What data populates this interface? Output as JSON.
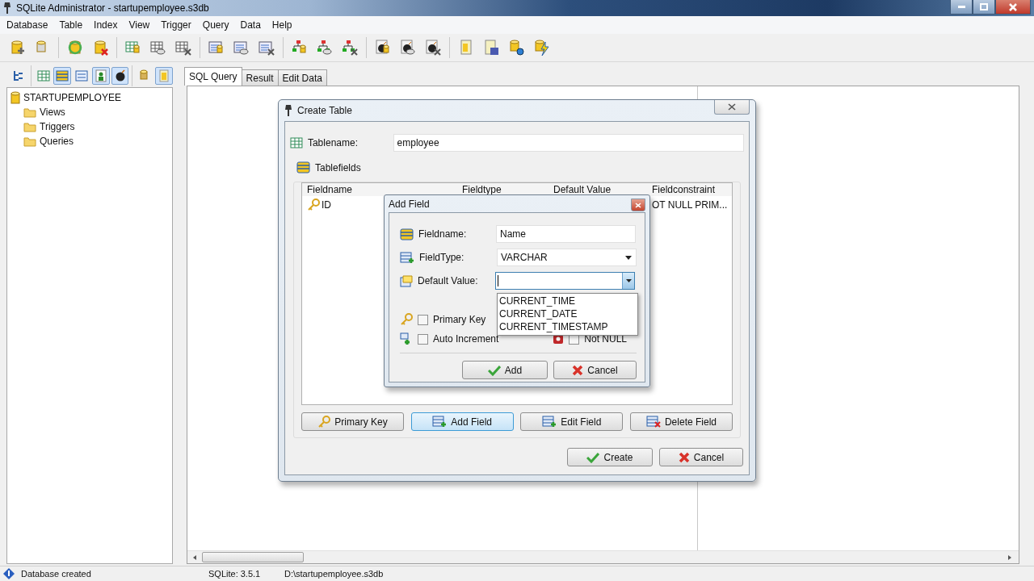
{
  "window": {
    "title": "SQLite Administrator - startupemployee.s3db"
  },
  "menu": [
    "Database",
    "Table",
    "Index",
    "View",
    "Trigger",
    "Query",
    "Data",
    "Help"
  ],
  "tree_toolbar": [
    {
      "pressed": false
    },
    {
      "pressed": false
    },
    {
      "pressed": true
    },
    {
      "pressed": false
    },
    {
      "pressed": true
    },
    {
      "pressed": true
    },
    {
      "pressed": false
    },
    {
      "pressed": true
    }
  ],
  "tree": {
    "label": "STARTUPEMPLOYEE",
    "children": [
      {
        "label": "Views"
      },
      {
        "label": "Triggers"
      },
      {
        "label": "Queries"
      }
    ]
  },
  "tabs": [
    {
      "label": "SQL Query",
      "selected": true
    },
    {
      "label": "Result",
      "selected": false
    },
    {
      "label": "Edit Data",
      "selected": false
    }
  ],
  "create_table": {
    "title": "Create Table",
    "tablename_label": "Tablename:",
    "tablename": "employee",
    "group_label": "Tablefields",
    "columns": [
      "Fieldname",
      "Fieldtype",
      "Default Value",
      "Fieldconstraint"
    ],
    "rows": [
      {
        "fieldname": "ID",
        "primary_key": true,
        "fieldconstraint": "OT NULL PRIM..."
      }
    ],
    "buttons": [
      {
        "label": "Primary Key",
        "focused": false
      },
      {
        "label": "Add Field",
        "focused": true
      },
      {
        "label": "Edit Field",
        "focused": false
      },
      {
        "label": "Delete Field",
        "focused": false
      }
    ],
    "footer_buttons": [
      {
        "label": "Create",
        "kind": "confirm"
      },
      {
        "label": "Cancel",
        "kind": "cancel"
      }
    ]
  },
  "add_field": {
    "title": "Add Field",
    "fields": [
      {
        "kind": "text",
        "label": "Fieldname:",
        "value": "Name"
      },
      {
        "kind": "select",
        "label": "FieldType:",
        "value": "VARCHAR"
      },
      {
        "kind": "combo",
        "label": "Default Value:",
        "open": true
      }
    ],
    "dropdown_options": [
      "CURRENT_TIME",
      "CURRENT_DATE",
      "CURRENT_TIMESTAMP"
    ],
    "checks": [
      {
        "label": "Primary Key",
        "checked": false
      },
      {
        "label": "Auto Increment",
        "checked": false
      },
      {
        "label": "Not NULL",
        "checked": false
      }
    ],
    "buttons": [
      {
        "label": "Add",
        "kind": "confirm"
      },
      {
        "label": "Cancel",
        "kind": "cancel"
      }
    ]
  },
  "status_bar": [
    "Database created",
    "SQLite: 3.5.1",
    "D:\\startupemployee.s3db"
  ]
}
